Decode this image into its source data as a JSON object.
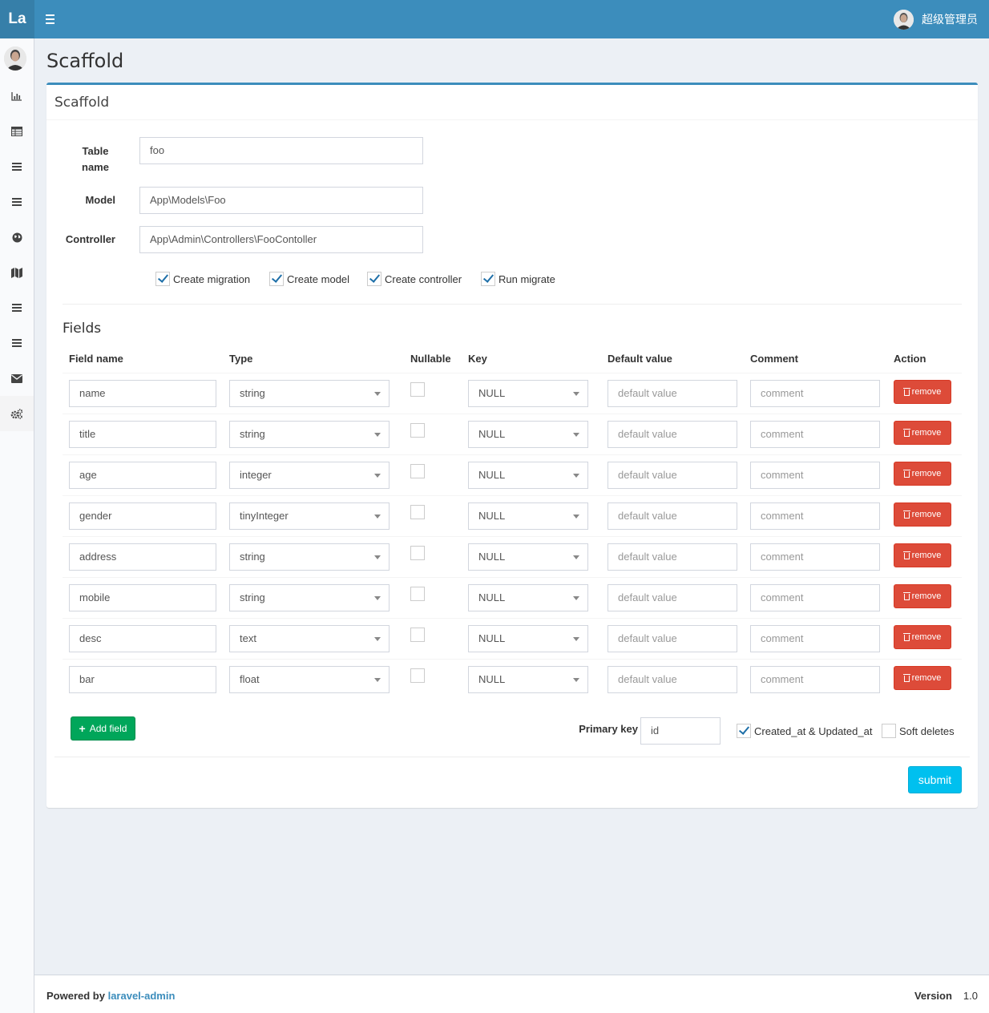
{
  "brand": {
    "logo": "La"
  },
  "user": {
    "name": "超级管理员"
  },
  "page": {
    "title": "Scaffold"
  },
  "box": {
    "title": "Scaffold"
  },
  "form": {
    "table_name_label": "Table name",
    "table_name_label_line1": "Table",
    "table_name_label_line2": "name",
    "table_name_value": "foo",
    "model_label": "Model",
    "model_value": "App\\Models\\Foo",
    "controller_label": "Controller",
    "controller_value": "App\\Admin\\Controllers\\FooContoller",
    "options": [
      {
        "label": "Create migration",
        "checked": true
      },
      {
        "label": "Create model",
        "checked": true
      },
      {
        "label": "Create controller",
        "checked": true
      },
      {
        "label": "Run migrate",
        "checked": true
      }
    ]
  },
  "fields": {
    "title": "Fields",
    "headers": {
      "field_name": "Field name",
      "type": "Type",
      "nullable": "Nullable",
      "key": "Key",
      "default_value": "Default value",
      "comment": "Comment",
      "action": "Action"
    },
    "rows": [
      {
        "name": "name",
        "type": "string",
        "nullable": false,
        "key": "NULL",
        "default_placeholder": "default value",
        "comment_placeholder": "comment",
        "action": "remove"
      },
      {
        "name": "title",
        "type": "string",
        "nullable": false,
        "key": "NULL",
        "default_placeholder": "default value",
        "comment_placeholder": "comment",
        "action": "remove"
      },
      {
        "name": "age",
        "type": "integer",
        "nullable": false,
        "key": "NULL",
        "default_placeholder": "default value",
        "comment_placeholder": "comment",
        "action": "remove"
      },
      {
        "name": "gender",
        "type": "tinyInteger",
        "nullable": false,
        "key": "NULL",
        "default_placeholder": "default value",
        "comment_placeholder": "comment",
        "action": "remove"
      },
      {
        "name": "address",
        "type": "string",
        "nullable": false,
        "key": "NULL",
        "default_placeholder": "default value",
        "comment_placeholder": "comment",
        "action": "remove"
      },
      {
        "name": "mobile",
        "type": "string",
        "nullable": false,
        "key": "NULL",
        "default_placeholder": "default value",
        "comment_placeholder": "comment",
        "action": "remove"
      },
      {
        "name": "desc",
        "type": "text",
        "nullable": false,
        "key": "NULL",
        "default_placeholder": "default value",
        "comment_placeholder": "comment",
        "action": "remove"
      },
      {
        "name": "bar",
        "type": "float",
        "nullable": false,
        "key": "NULL",
        "default_placeholder": "default value",
        "comment_placeholder": "comment",
        "action": "remove"
      }
    ]
  },
  "bottom": {
    "add_field": "Add field",
    "primary_key_label": "Primary key",
    "primary_key_value": "id",
    "timestamps_label": "Created_at & Updated_at",
    "timestamps_checked": true,
    "soft_deletes_label": "Soft deletes",
    "soft_deletes_checked": false,
    "submit": "submit"
  },
  "sidebar": {
    "items": [
      {
        "icon": "bar-chart-icon"
      },
      {
        "icon": "table-icon"
      },
      {
        "icon": "list-icon"
      },
      {
        "icon": "list-icon"
      },
      {
        "icon": "globe-icon"
      },
      {
        "icon": "map-icon"
      },
      {
        "icon": "list-icon"
      },
      {
        "icon": "list-icon"
      },
      {
        "icon": "envelope-icon"
      },
      {
        "icon": "cogs-icon"
      }
    ]
  },
  "footer": {
    "powered_by": "Powered by",
    "link": "laravel-admin",
    "version_label": "Version",
    "version_value": "1.0"
  },
  "colors": {
    "primary": "#3c8dbc",
    "danger": "#dd4b39",
    "success": "#00a65a",
    "info": "#00c0ef"
  }
}
